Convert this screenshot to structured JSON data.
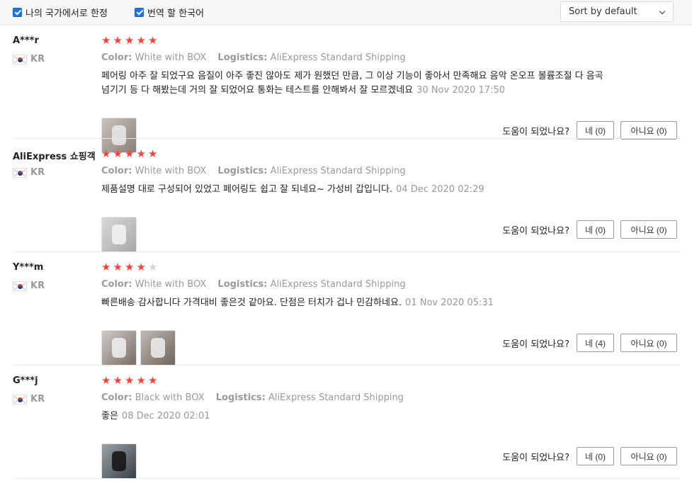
{
  "filters": {
    "country_only_label": "나의 국가에서로 한정",
    "translate_label": "번역 할 한국어",
    "sort": {
      "selected": "Sort by default"
    }
  },
  "labels": {
    "color_key": "Color:",
    "logistics_key": "Logistics:",
    "helpful_question": "도움이 되었나요?"
  },
  "reviews": [
    {
      "user": "A***r",
      "country": "KR",
      "rating": 5,
      "color": "White with BOX",
      "logistics": "AliExpress Standard Shipping",
      "text": "페어링 아주 잘 되었구요 음질이 아주 좋진 않아도 제가 원했던 만큼, 그 이상 기능이 좋아서 만족해요 음악 온오프 볼륨조절 다 음곡넘기기 등 다 해봤는데 거의 잘 되었어요 통화는 테스트를 안해봐서 잘 모르겠네요",
      "date": "30 Nov 2020 17:50",
      "photos": [
        "product-photo"
      ],
      "yes_label": "네 (0)",
      "no_label": "아니요 (0)"
    },
    {
      "user": "AliExpress 쇼핑객",
      "country": "KR",
      "rating": 5,
      "color": "White with BOX",
      "logistics": "AliExpress Standard Shipping",
      "text": "제품설명 대로 구성되어 있었고 페어링도 쉽고 잘 되네요~ 가성비 갑입니다.",
      "date": "04 Dec 2020 02:29",
      "photos": [
        "product-photo"
      ],
      "yes_label": "네 (0)",
      "no_label": "아니요 (0)"
    },
    {
      "user": "Y***m",
      "country": "KR",
      "rating": 4,
      "color": "White with BOX",
      "logistics": "AliExpress Standard Shipping",
      "text": "빠른배송 감사합니다 가격대비 좋은것 같아요. 단점은 터치가 겁나 민감하네요.",
      "date": "01 Nov 2020 05:31",
      "photos": [
        "product-photo",
        "product-photo"
      ],
      "yes_label": "네 (4)",
      "no_label": "아니요 (0)"
    },
    {
      "user": "G***j",
      "country": "KR",
      "rating": 5,
      "color": "Black with BOX",
      "logistics": "AliExpress Standard Shipping",
      "text": "좋은",
      "date": "08 Dec 2020 02:01",
      "photos": [
        "product-photo"
      ],
      "yes_label": "네 (0)",
      "no_label": "아니요 (0)"
    }
  ],
  "colors": {
    "star": "#f44336",
    "star_empty": "#d6d6d6",
    "checkbox": "#1a73e8",
    "muted": "#999999"
  },
  "icons": {
    "star": "star-icon",
    "flag": "kr-flag-icon",
    "chevron": "chevron-down-icon",
    "checkbox": "checkbox-checked-icon"
  }
}
